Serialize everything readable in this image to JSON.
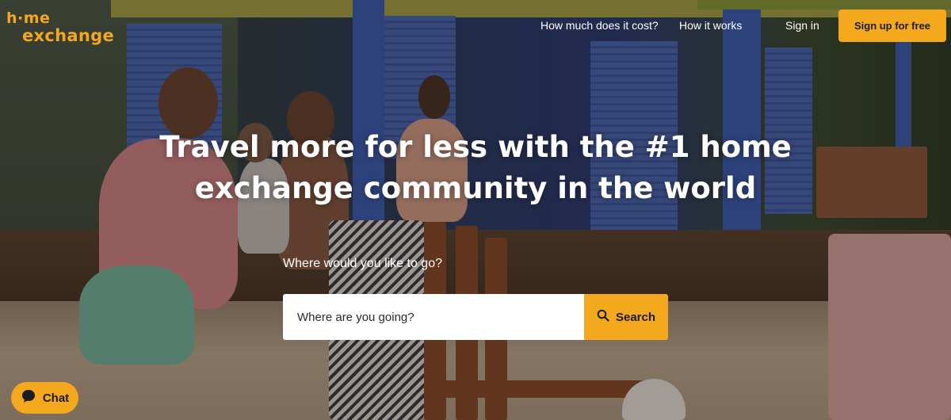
{
  "brand": {
    "logo_line1": "h·me",
    "logo_line2": "exchange",
    "accent_color": "#f4a81d"
  },
  "nav": {
    "cost_link": "How much does it cost?",
    "how_link": "How it works",
    "signin_link": "Sign in",
    "signup_button": "Sign up for free"
  },
  "hero": {
    "title": "Travel more for less with the #1 home exchange community in the world",
    "search_label": "Where would you like to go?",
    "search_placeholder": "Where are you going?",
    "search_button": "Search",
    "search_icon": "search-icon"
  },
  "chat": {
    "label": "Chat",
    "icon": "chat-bubble-icon"
  }
}
